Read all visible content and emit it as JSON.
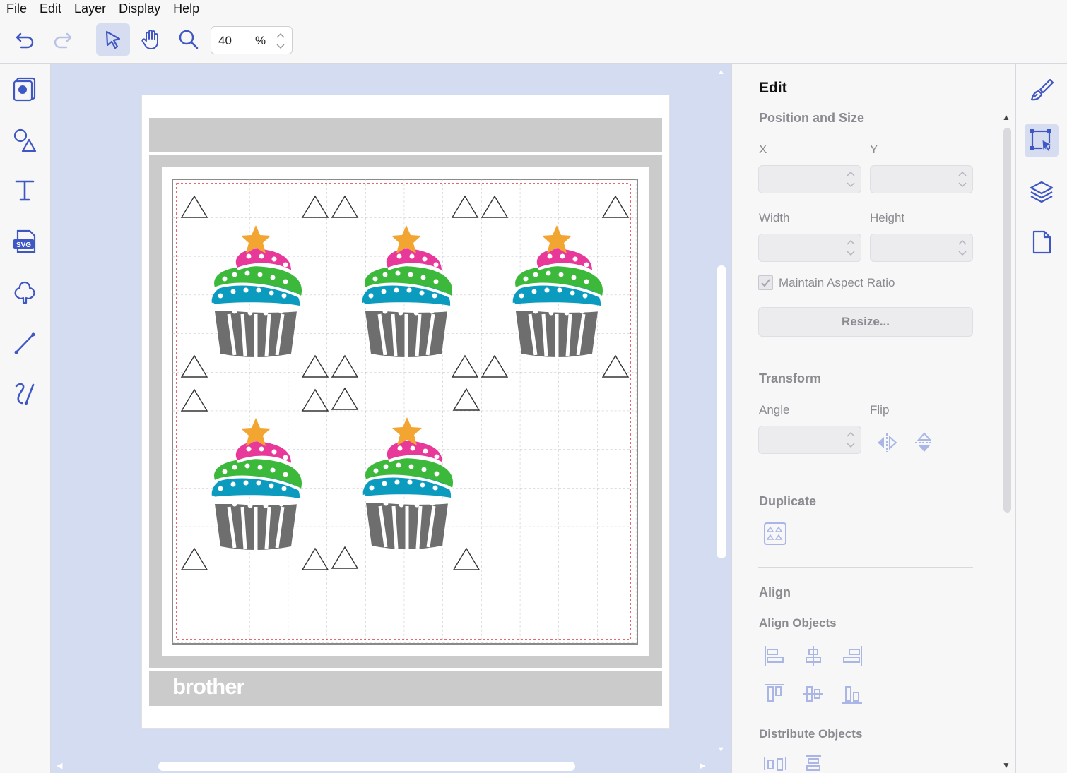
{
  "menu": [
    "File",
    "Edit",
    "Layer",
    "Display",
    "Help"
  ],
  "toolbar": {
    "icons": [
      "undo-icon",
      "redo-icon",
      "select-icon",
      "pan-hand-icon",
      "zoom-icon"
    ],
    "zoom_value": "40",
    "zoom_unit": "%"
  },
  "left_tools": [
    "project-icon",
    "shapes-icon",
    "text-icon",
    "svg-import-icon",
    "pattern-icon",
    "line-icon",
    "freehand-icon"
  ],
  "mat": {
    "brand": "brother"
  },
  "panel": {
    "title": "Edit",
    "position_size": {
      "heading": "Position and Size",
      "x_label": "X",
      "y_label": "Y",
      "width_label": "Width",
      "height_label": "Height",
      "x_value": "",
      "y_value": "",
      "width_value": "",
      "height_value": "",
      "aspect_label": "Maintain Aspect Ratio",
      "aspect_checked": true,
      "resize_label": "Resize..."
    },
    "transform": {
      "heading": "Transform",
      "angle_label": "Angle",
      "flip_label": "Flip",
      "angle_value": ""
    },
    "duplicate": {
      "heading": "Duplicate"
    },
    "align": {
      "heading": "Align",
      "align_objects_label": "Align Objects",
      "distribute_label": "Distribute Objects"
    }
  },
  "right_strip": [
    "paintbrush-icon",
    "edit-transform-icon",
    "layers-icon",
    "page-icon"
  ],
  "colors": {
    "accent": "#4a5fc1",
    "canvas_bg": "#d4dcf1",
    "frosting_pink": "#e8399b",
    "frosting_green": "#3cb83a",
    "frosting_teal": "#0b9bbf",
    "star": "#f2a531",
    "wrapper": "#6e6e6e",
    "mat_border": "#cbcbcb",
    "cut_line": "#e0343b"
  }
}
